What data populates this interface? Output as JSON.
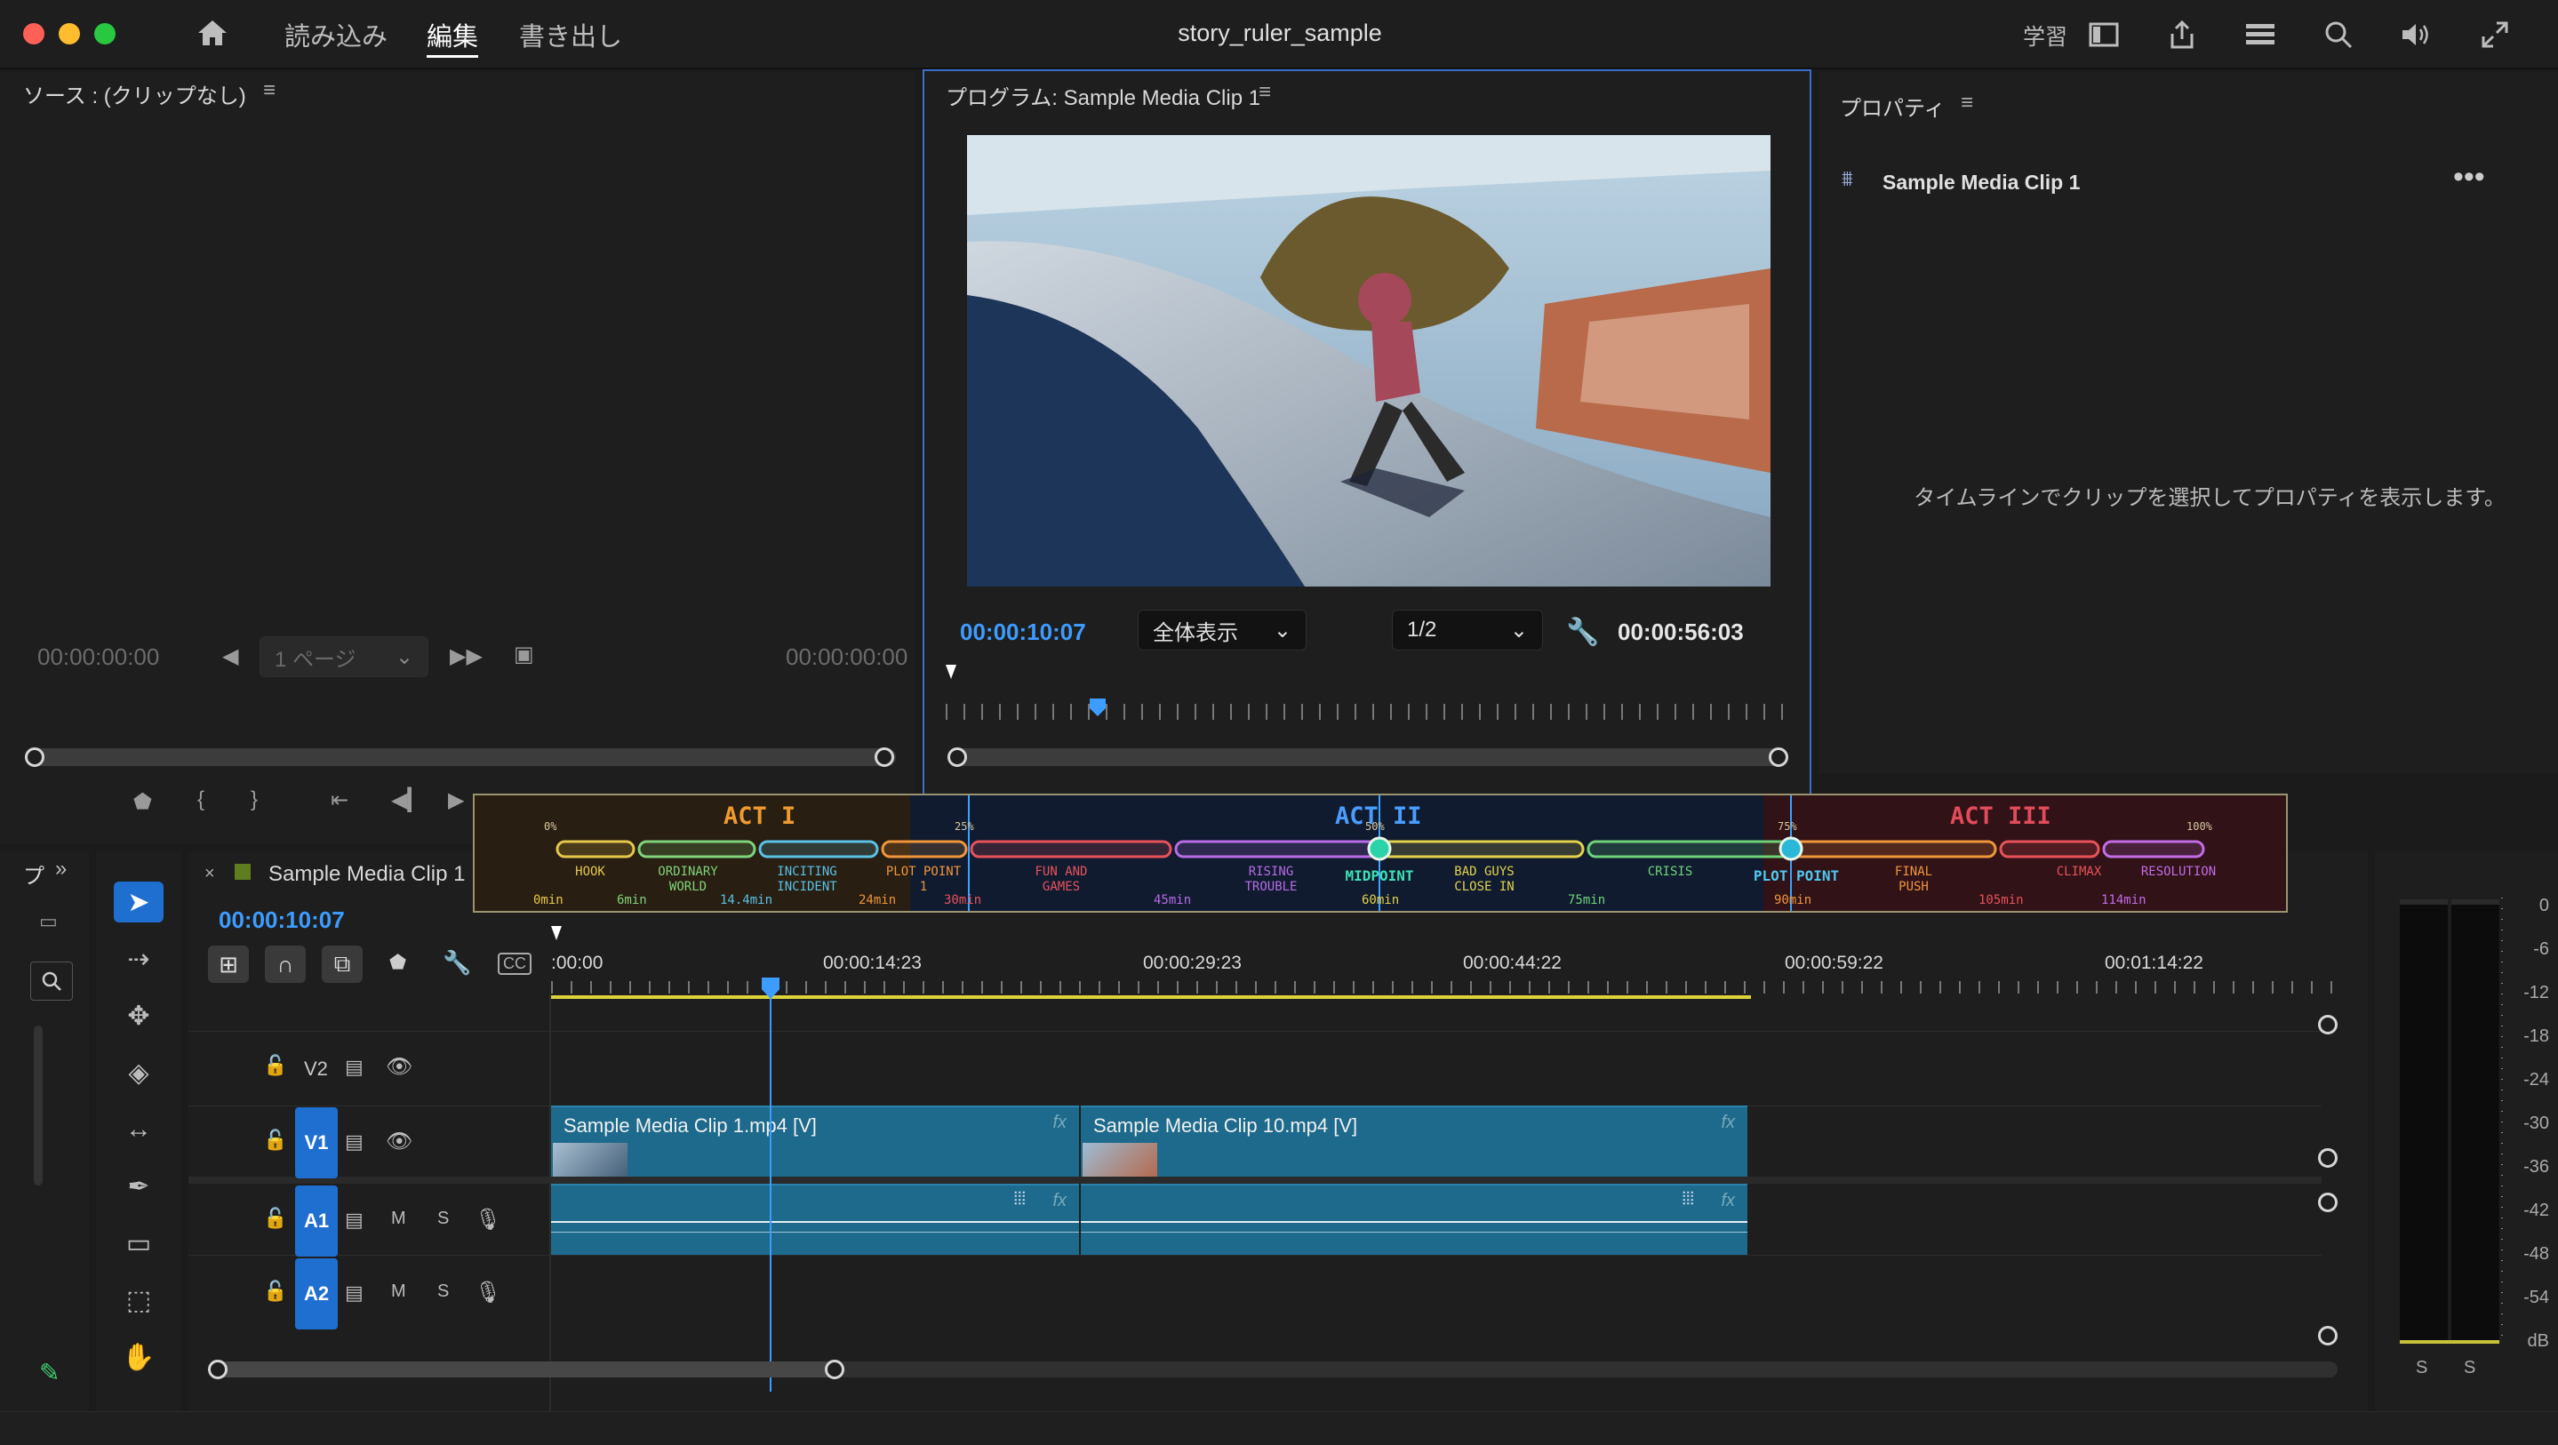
{
  "window": {
    "title": "story_ruler_sample"
  },
  "menu": {
    "import": "読み込み",
    "edit": "編集",
    "export": "書き出し"
  },
  "toolbar_right": {
    "learn": "学習"
  },
  "source": {
    "title": "ソース : (クリップなし)",
    "tc_in": "00:00:00:00",
    "page": "1 ページ",
    "tc_out": "00:00:00:00"
  },
  "program": {
    "title": "プログラム: Sample Media Clip 1",
    "tc_current": "00:00:10:07",
    "fit": "全体表示",
    "resolution": "1/2",
    "tc_duration": "00:00:56:03"
  },
  "properties": {
    "title": "プロパティ",
    "clip_name": "Sample Media Clip 1",
    "empty_msg": "タイムラインでクリップを選択してプロパティを表示します。"
  },
  "ruler": {
    "acts": [
      "ACT I",
      "ACT II",
      "ACT III"
    ],
    "percents": [
      "0%",
      "25%",
      "50%",
      "75%",
      "100%"
    ],
    "beats": [
      {
        "l1": "HOOK",
        "l2": ""
      },
      {
        "l1": "ORDINARY",
        "l2": "WORLD"
      },
      {
        "l1": "INCITING",
        "l2": "INCIDENT"
      },
      {
        "l1": "PLOT POINT",
        "l2": "1"
      },
      {
        "l1": "FUN AND",
        "l2": "GAMES"
      },
      {
        "l1": "RISING",
        "l2": "TROUBLE"
      },
      {
        "l1": "MIDPOINT",
        "l2": ""
      },
      {
        "l1": "BAD GUYS",
        "l2": "CLOSE IN"
      },
      {
        "l1": "CRISIS",
        "l2": ""
      },
      {
        "l1": "PLOT POINT",
        "l2": ""
      },
      {
        "l1": "FINAL",
        "l2": "PUSH"
      },
      {
        "l1": "CLIMAX",
        "l2": ""
      },
      {
        "l1": "RESOLUTION",
        "l2": ""
      }
    ],
    "minutes": [
      "0min",
      "6min",
      "14.4min",
      "24min",
      "30min",
      "45min",
      "60min",
      "75min",
      "90min",
      "105min",
      "114min"
    ]
  },
  "timeline": {
    "seq_name": "Sample Media Clip 1",
    "tc": "00:00:10:07",
    "ticks": [
      ":00:00",
      "00:00:14:23",
      "00:00:29:23",
      "00:00:44:22",
      "00:00:59:22",
      "00:01:14:22"
    ],
    "tracks": {
      "v2": "V2",
      "v1": "V1",
      "a1": "A1",
      "a2": "A2",
      "m": "M",
      "s": "S"
    },
    "clips": {
      "c1": "Sample Media Clip 1.mp4 [V]",
      "c2": "Sample Media Clip 10.mp4 [V]",
      "fx": "fx"
    },
    "panel_short": "プ"
  },
  "meters": {
    "scale": [
      "0",
      "-6",
      "-12",
      "-18",
      "-24",
      "-30",
      "-36",
      "-42",
      "-48",
      "-54",
      "dB"
    ],
    "s": "S"
  }
}
